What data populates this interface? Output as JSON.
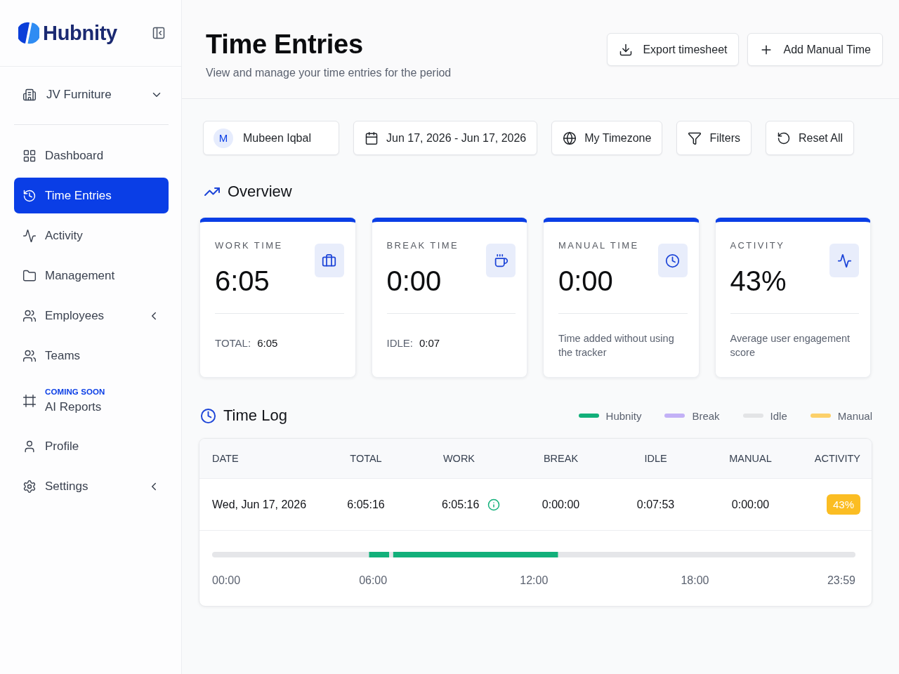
{
  "sidebar": {
    "brand": "Hubnity",
    "company": "JV Furniture",
    "nav": [
      {
        "label": "Dashboard",
        "kind": "link",
        "selected": false
      },
      {
        "label": "Time Entries",
        "kind": "link",
        "selected": true
      },
      {
        "label": "Activity",
        "kind": "link",
        "selected": false
      },
      {
        "label": "Management",
        "kind": "link",
        "selected": false
      },
      {
        "label": "Employees",
        "kind": "group",
        "expanded": false,
        "selected": false
      },
      {
        "label": "Teams",
        "kind": "link",
        "selected": false
      },
      {
        "label": "AI Reports",
        "kind": "link",
        "badge": "COMING SOON",
        "selected": false
      },
      {
        "label": "Profile",
        "kind": "link",
        "selected": false
      },
      {
        "label": "Settings",
        "kind": "group",
        "expanded": false,
        "selected": false
      }
    ]
  },
  "header": {
    "title": "Time Entries",
    "subtitle": "View and manage your time entries for the period",
    "actions": [
      {
        "label": "Export timesheet"
      },
      {
        "label": "Add Manual Time"
      }
    ]
  },
  "filters": [
    {
      "kind": "user",
      "initial": "M",
      "label": "Mubeen Iqbal"
    },
    {
      "kind": "button",
      "label": "Jun 17, 2026 - Jun 17, 2026"
    },
    {
      "kind": "button",
      "label": "My Timezone"
    },
    {
      "kind": "button",
      "label": "Filters"
    },
    {
      "kind": "button",
      "label": "Reset All"
    }
  ],
  "overview": {
    "title": "Overview",
    "cards": [
      {
        "label": "WORK TIME",
        "value": "6:05",
        "footer": {
          "label": "TOTAL:",
          "value": "6:05"
        }
      },
      {
        "label": "BREAK TIME",
        "value": "0:00",
        "footer": {
          "label": "IDLE:",
          "value": "0:07"
        }
      },
      {
        "label": "MANUAL TIME",
        "value": "0:00",
        "note": "Time added without using the tracker"
      },
      {
        "label": "ACTIVITY",
        "value": "43%",
        "note": "Average user engagement score"
      }
    ]
  },
  "time_log": {
    "title": "Time Log",
    "legend": [
      {
        "label": "Hubnity",
        "color": "#12b07a"
      },
      {
        "label": "Break",
        "color": "#c3b1f6"
      },
      {
        "label": "Idle",
        "color": "#e3e4e6"
      },
      {
        "label": "Manual",
        "color": "#fcd06a"
      }
    ],
    "table": {
      "columns": [
        "DATE",
        "TOTAL",
        "WORK",
        "BREAK",
        "IDLE",
        "MANUAL",
        "ACTIVITY"
      ],
      "rows": [
        {
          "cells": [
            "Wed, Jun 17, 2026",
            "6:05:16",
            "6:05:16",
            "0:00:00",
            "0:07:53",
            "0:00:00",
            "43%"
          ]
        }
      ]
    },
    "timeline": {
      "chart_data": {
        "type": "bar",
        "orientation": "horizontal",
        "stacked": true,
        "categories": [
          null
        ],
        "xlim": [
          0,
          23.983
        ],
        "xticks": [
          {
            "value": 0,
            "label": "00:00"
          },
          {
            "value": 6,
            "label": "06:00"
          },
          {
            "value": 12,
            "label": "12:00"
          },
          {
            "value": 18,
            "label": "18:00"
          },
          {
            "value": 23.983,
            "label": "23:59"
          }
        ],
        "series": [
          {
            "color": "#e5e6e9",
            "values": [
              5.85
            ]
          },
          {
            "color": "#12b07a",
            "values": [
              0.75
            ]
          },
          {
            "color": "#e5e6e9",
            "values": [
              0.15
            ]
          },
          {
            "color": "#12b07a",
            "values": [
              6.15
            ]
          },
          {
            "color": "#e5e6e9",
            "values": [
              11.083
            ]
          }
        ]
      }
    }
  }
}
